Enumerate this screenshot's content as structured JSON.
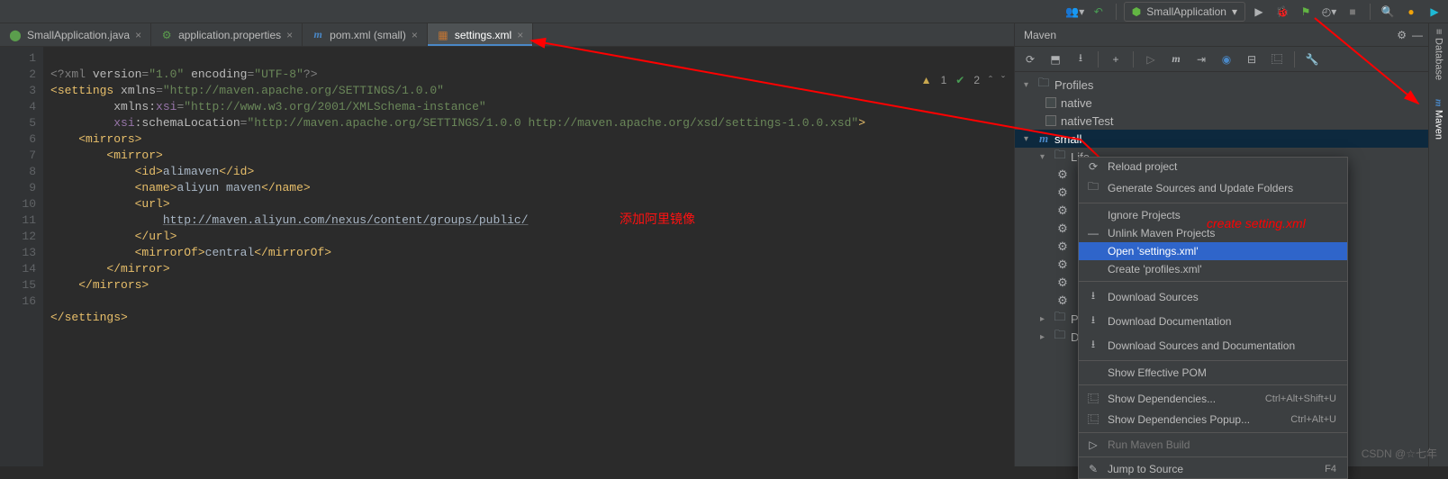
{
  "top": {
    "run_config": "SmallApplication"
  },
  "tabs": [
    {
      "label": "SmallApplication.java",
      "icon": "java"
    },
    {
      "label": "application.properties",
      "icon": "props"
    },
    {
      "label": "pom.xml (small)",
      "icon": "maven"
    },
    {
      "label": "settings.xml",
      "icon": "xml",
      "active": true
    }
  ],
  "gutter_lines": [
    "1",
    "2",
    "3",
    "4",
    "5",
    "6",
    "7",
    "8",
    "9",
    "10",
    "11",
    "12",
    "13",
    "14",
    "15",
    "16"
  ],
  "status": {
    "warn_count": "1",
    "ok_count": "2"
  },
  "code": {
    "l1_pre": "<?xml ",
    "l1_a1": "version",
    "l1_v1": "\"1.0\"",
    "l1_a2": "encoding",
    "l1_v2": "\"UTF-8\"",
    "l1_post": "?>",
    "l2_open": "<",
    "l2_tag": "settings",
    "l2_a1": "xmlns",
    "l2_v1": "\"http://maven.apache.org/SETTINGS/1.0.0\"",
    "l3_ns": "xmlns:",
    "l3_nsn": "xsi",
    "l3_v": "\"http://www.w3.org/2001/XMLSchema-instance\"",
    "l4_ns": "xsi",
    "l4_a": ":schemaLocation",
    "l4_v": "\"http://maven.apache.org/SETTINGS/1.0.0 http://maven.apache.org/xsd/settings-1.0.0.xsd\"",
    "l4_close": ">",
    "l5": "<mirrors>",
    "l6": "<mirror>",
    "l7_o": "<id>",
    "l7_t": "alimaven",
    "l7_c": "</id>",
    "l8_o": "<name>",
    "l8_t": "aliyun maven",
    "l8_c": "</name>",
    "l9": "<url>",
    "l10": "http://maven.aliyun.com/nexus/content/groups/public/",
    "l11": "</url>",
    "l12_o": "<mirrorOf>",
    "l12_t": "central",
    "l12_c": "</mirrorOf>",
    "l13": "</mirror>",
    "l14": "</mirrors>",
    "l16": "</settings>"
  },
  "annotation_editor": "添加阿里镜像",
  "annotation_menu": "create setting.xml",
  "maven": {
    "title": "Maven",
    "tree": {
      "profiles": "Profiles",
      "native": "native",
      "nativeTest": "nativeTest",
      "small": "small",
      "lifecycle": "Life",
      "plugins": "Plu",
      "deps": "Dep"
    }
  },
  "menu": {
    "reload": "Reload project",
    "generate": "Generate Sources and Update Folders",
    "ignore": "Ignore Projects",
    "unlink": "Unlink Maven Projects",
    "open": "Open 'settings.xml'",
    "create": "Create 'profiles.xml'",
    "dlsrc": "Download Sources",
    "dldoc": "Download Documentation",
    "dlboth": "Download Sources and Documentation",
    "effpom": "Show Effective POM",
    "showdep": "Show Dependencies...",
    "showdep_sc": "Ctrl+Alt+Shift+U",
    "showdepp": "Show Dependencies Popup...",
    "showdepp_sc": "Ctrl+Alt+U",
    "runbuild": "Run Maven Build",
    "jump": "Jump to Source",
    "jump_sc": "F4"
  },
  "rail": {
    "db": "Database",
    "mvn": "Maven"
  },
  "watermark": "CSDN @☆七年"
}
